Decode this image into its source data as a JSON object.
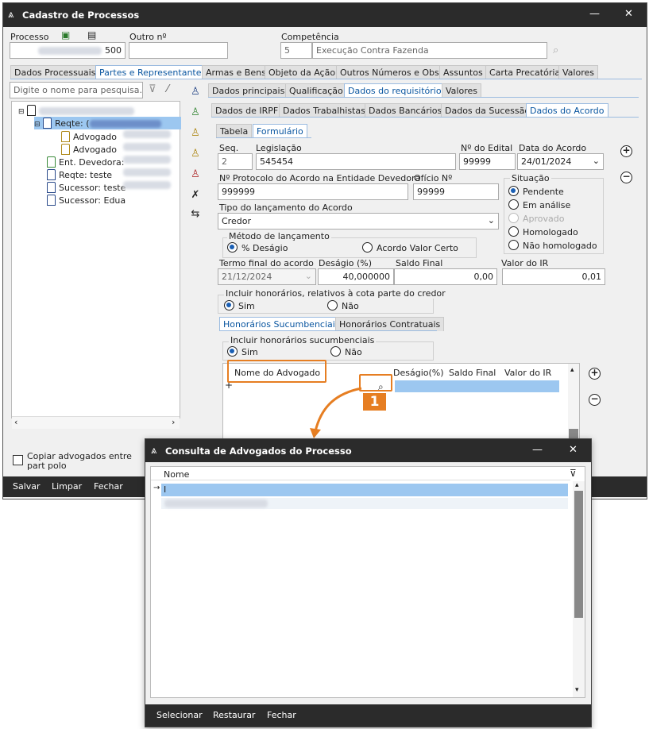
{
  "window": {
    "title": "Cadastro de Processos",
    "minimize": "—",
    "close": "✕"
  },
  "header": {
    "processo_label": "Processo",
    "processo_value": "500",
    "outro_label": "Outro nº",
    "outro_value": "",
    "competencia_label": "Competência",
    "competencia_code": "5",
    "competencia_desc": "Execução Contra Fazenda"
  },
  "main_tabs": [
    "Dados Processuais",
    "Partes e Representantes",
    "Armas e Bens",
    "Objeto da Ação",
    "Outros Números e Obs.",
    "Assuntos",
    "Carta Precatória",
    "Valores"
  ],
  "search": {
    "placeholder": "Digite o nome para pesquisa..."
  },
  "tree": {
    "items": [
      {
        "label": ""
      },
      {
        "label": "Reqte: ("
      },
      {
        "label": "Advogado"
      },
      {
        "label": "Advogado"
      },
      {
        "label": "Ent. Devedora:"
      },
      {
        "label": "Reqte: teste"
      },
      {
        "label": "Sucessor: teste"
      },
      {
        "label": "Sucessor: Edua"
      }
    ]
  },
  "sub_tabs": [
    "Dados principais",
    "Qualificação",
    "Dados do requisitório",
    "Valores"
  ],
  "sub_tabs2": [
    "Dados de IRPF",
    "Dados Trabalhistas",
    "Dados Bancários",
    "Dados da Sucessão",
    "Dados do Acordo"
  ],
  "sub_tabs3": [
    "Tabela",
    "Formulário"
  ],
  "form": {
    "seq_label": "Seq.",
    "seq_value": "2",
    "legislacao_label": "Legislação",
    "legislacao_value": "545454",
    "edital_label": "Nº do Edital",
    "edital_value": "99999",
    "data_acordo_label": "Data do Acordo",
    "data_acordo_value": "24/01/2024",
    "protocolo_label": "Nº Protocolo do Acordo na Entidade Devedora",
    "protocolo_value": "999999",
    "oficio_label": "Ofício Nº",
    "oficio_value": "99999",
    "situacao_label": "Situação",
    "situacao_options": [
      "Pendente",
      "Em análise",
      "Aprovado",
      "Homologado",
      "Não homologado"
    ],
    "tipo_label": "Tipo do lançamento do Acordo",
    "tipo_value": "Credor",
    "metodo_label": "Método de lançamento",
    "metodo_opt1": "% Deságio",
    "metodo_opt2": "Acordo Valor Certo",
    "termo_label": "Termo final do acordo",
    "termo_value": "21/12/2024",
    "desagio_label": "Deságio (%)",
    "desagio_value": "40,000000",
    "saldo_label": "Saldo Final",
    "saldo_value": "0,00",
    "ir_label": "Valor do IR",
    "ir_value": "0,01",
    "incluir_cota_label": "Incluir honorários, relativos à cota parte do credor",
    "sim": "Sim",
    "nao": "Não",
    "hon_tabs": [
      "Honorários Sucumbenciais",
      "Honorários Contratuais"
    ],
    "incluir_suc_label": "Incluir honorários sucumbenciais",
    "grid_headers": [
      "Nome do Advogado",
      "Deságio(%)",
      "Saldo Final",
      "Valor do IR"
    ]
  },
  "copy_label": "Copiar advogados entre part polo",
  "bottom_buttons": [
    "Salvar",
    "Limpar",
    "Fechar"
  ],
  "callout": "1",
  "dialog": {
    "title": "Consulta de Advogados do Processo",
    "minimize": "—",
    "close": "✕",
    "header": "Nome",
    "row_value": "I",
    "buttons": [
      "Selecionar",
      "Restaurar",
      "Fechar"
    ]
  },
  "colors": {
    "accent": "#e67e22",
    "dark": "#2b2b2b",
    "selection": "#9cc7f0"
  }
}
